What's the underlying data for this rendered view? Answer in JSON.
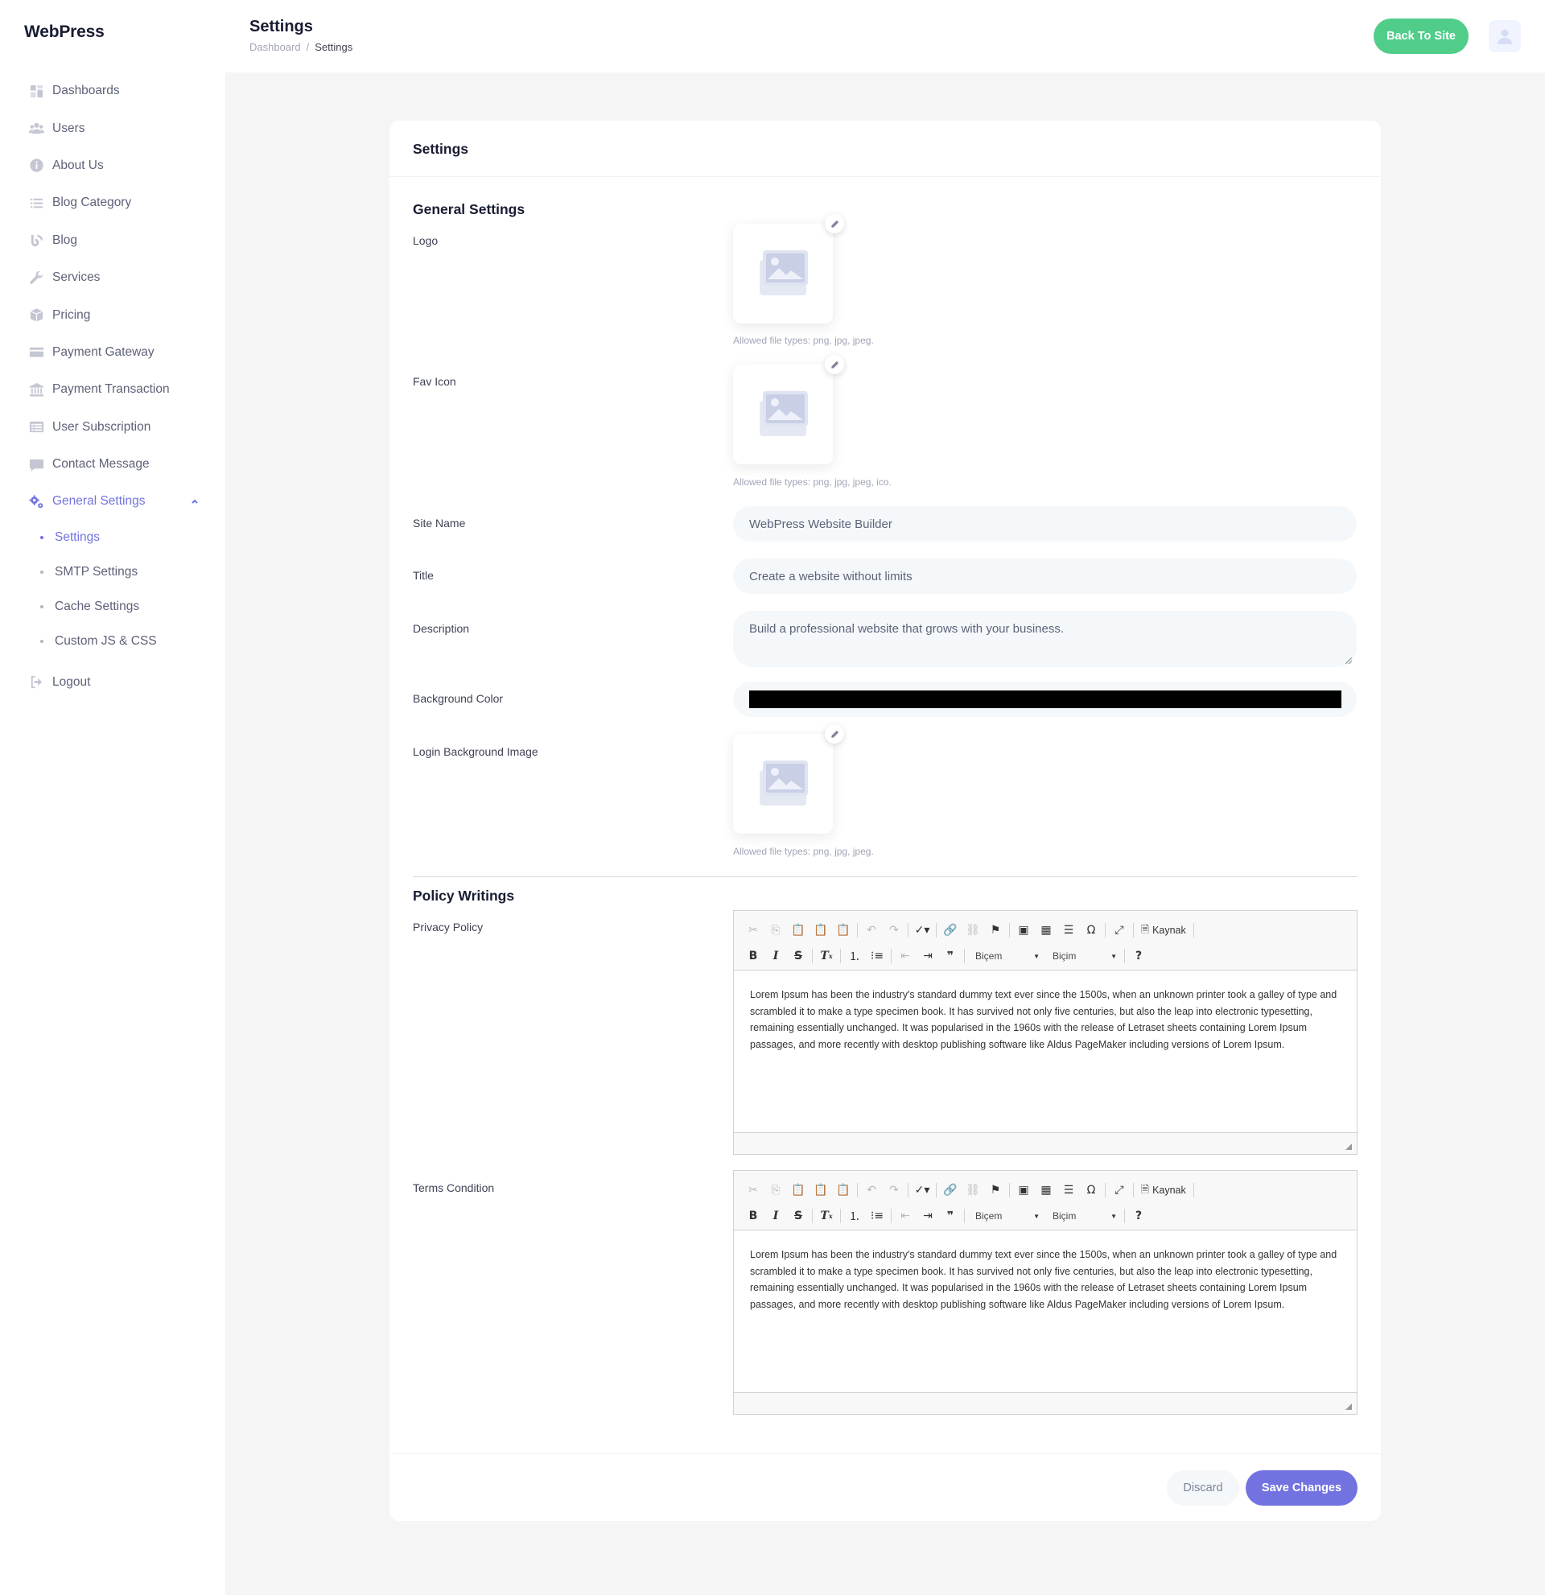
{
  "brand": "WebPress",
  "sidebar": {
    "items": [
      {
        "label": "Dashboards",
        "icon": "dashboard-icon"
      },
      {
        "label": "Users",
        "icon": "users-icon"
      },
      {
        "label": "About Us",
        "icon": "info-icon"
      },
      {
        "label": "Blog Category",
        "icon": "list-icon"
      },
      {
        "label": "Blog",
        "icon": "blog-icon"
      },
      {
        "label": "Services",
        "icon": "wrench-icon"
      },
      {
        "label": "Pricing",
        "icon": "box-icon"
      },
      {
        "label": "Payment Gateway",
        "icon": "credit-card-icon"
      },
      {
        "label": "Payment Transaction",
        "icon": "bank-icon"
      },
      {
        "label": "User Subscription",
        "icon": "table-icon"
      },
      {
        "label": "Contact Message",
        "icon": "message-icon"
      }
    ],
    "general_settings": {
      "label": "General Settings",
      "icon": "gears-icon",
      "expanded": true,
      "children": [
        {
          "label": "Settings",
          "active": true
        },
        {
          "label": "SMTP Settings"
        },
        {
          "label": "Cache Settings"
        },
        {
          "label": "Custom JS & CSS"
        }
      ]
    },
    "logout": "Logout"
  },
  "header": {
    "title": "Settings",
    "breadcrumb": [
      "Dashboard",
      "/",
      "Settings"
    ],
    "back_button": "Back To Site"
  },
  "card": {
    "title": "Settings",
    "general_section": "General Settings",
    "logo": {
      "label": "Logo",
      "hint": "Allowed file types: png, jpg, jpeg."
    },
    "favicon": {
      "label": "Fav Icon",
      "hint": "Allowed file types: png, jpg, jpeg, ico."
    },
    "site_name": {
      "label": "Site Name",
      "value": "WebPress Website Builder"
    },
    "title_field": {
      "label": "Title",
      "value": "Create a website without limits"
    },
    "description": {
      "label": "Description",
      "value": "Build a professional website that grows with your business."
    },
    "background_color": {
      "label": "Background Color",
      "value": "#000000"
    },
    "login_bg": {
      "label": "Login Background Image",
      "hint": "Allowed file types: png, jpg, jpeg."
    },
    "policy_section": "Policy Writings",
    "privacy_policy": {
      "label": "Privacy Policy",
      "content": "Lorem Ipsum has been the industry's standard dummy text ever since the 1500s, when an unknown printer took a galley of type and scrambled it to make a type specimen book. It has survived not only five centuries, but also the leap into electronic typesetting, remaining essentially unchanged. It was popularised in the 1960s with the release of Letraset sheets containing Lorem Ipsum passages, and more recently with desktop publishing software like Aldus PageMaker including versions of Lorem Ipsum."
    },
    "terms_condition": {
      "label": "Terms Condition",
      "content": "Lorem Ipsum has been the industry's standard dummy text ever since the 1500s, when an unknown printer took a galley of type and scrambled it to make a type specimen book. It has survived not only five centuries, but also the leap into electronic typesetting, remaining essentially unchanged. It was popularised in the 1960s with the release of Letraset sheets containing Lorem Ipsum passages, and more recently with desktop publishing software like Aldus PageMaker including versions of Lorem Ipsum."
    },
    "editor": {
      "source_label": "Kaynak",
      "style_combo": "Biçem",
      "format_combo": "Biçim"
    },
    "discard_button": "Discard",
    "save_button": "Save Changes"
  },
  "colors": {
    "accent": "#7273e0",
    "success": "#50cd89",
    "sidebar_bg": "#ffffff",
    "page_bg": "#f5f5f5"
  }
}
